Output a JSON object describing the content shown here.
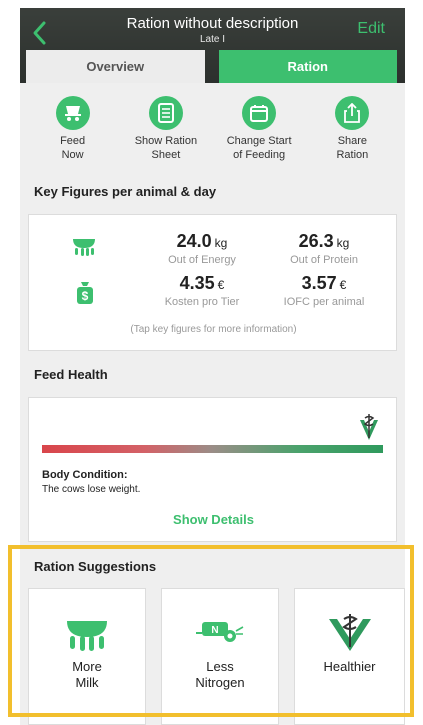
{
  "header": {
    "title": "Ration without description",
    "subtitle": "Late I",
    "edit_label": "Edit"
  },
  "tabs": [
    {
      "label": "Overview",
      "active": false
    },
    {
      "label": "Ration",
      "active": true
    }
  ],
  "actions": [
    {
      "label_line1": "Feed",
      "label_line2": "Now",
      "icon": "feed-cart-icon"
    },
    {
      "label_line1": "Show Ration",
      "label_line2": "Sheet",
      "icon": "ration-sheet-icon"
    },
    {
      "label_line1": "Change Start",
      "label_line2": "of Feeding",
      "icon": "calendar-icon"
    },
    {
      "label_line1": "Share",
      "label_line2": "Ration",
      "icon": "share-icon"
    }
  ],
  "key_figures": {
    "title": "Key Figures per animal & day",
    "energy": {
      "value": "24.0",
      "unit": "kg",
      "label": "Out of Energy"
    },
    "protein": {
      "value": "26.3",
      "unit": "kg",
      "label": "Out of Protein"
    },
    "cost": {
      "value": "4.35",
      "unit": "€",
      "label": "Kosten pro Tier"
    },
    "iofc": {
      "value": "3.57",
      "unit": "€",
      "label": "IOFC per animal"
    },
    "hint": "(Tap key figures for more information)"
  },
  "feed_health": {
    "title": "Feed Health",
    "body_condition_title": "Body Condition:",
    "body_condition_text": "The cows lose weight.",
    "show_details_label": "Show Details",
    "indicator_position": 0.96
  },
  "suggestions": {
    "title": "Ration Suggestions",
    "items": [
      {
        "line1": "More",
        "line2": "Milk",
        "icon": "udder-icon"
      },
      {
        "line1": "Less",
        "line2": "Nitrogen",
        "icon": "nitrogen-spreader-icon"
      },
      {
        "line1": "Healthier",
        "line2": "",
        "icon": "vet-symbol-icon"
      }
    ]
  },
  "colors": {
    "accent": "#3dbf6f",
    "highlight": "#f2bf2d",
    "bar_start": "#d9454b",
    "bar_end": "#2f9a5d"
  }
}
